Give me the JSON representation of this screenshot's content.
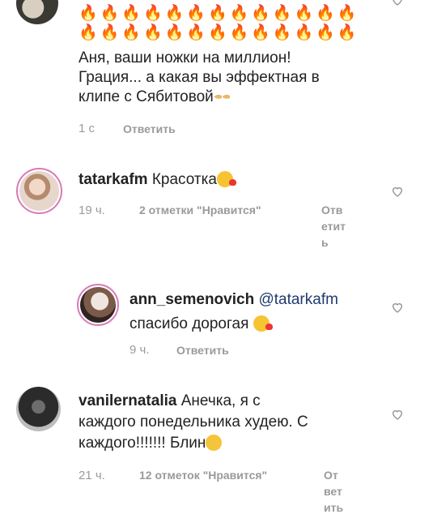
{
  "comment1": {
    "fires_row1": "🔥🔥🔥🔥🔥🔥🔥🔥🔥🔥🔥🔥🔥",
    "fires_row2": "🔥🔥🔥🔥🔥🔥🔥🔥🔥🔥🔥🔥🔥",
    "line1": "Аня, ваши ножки на миллион!",
    "line2": "Грация... а какая вы эффектная в",
    "line3": "клипе с Сябитовой",
    "time": "1 с",
    "reply": "Ответить"
  },
  "comment2": {
    "username": "tatarkafm",
    "text": "Красотка",
    "time": "19 ч.",
    "likes": "2 отметки \"Нравится\"",
    "reply_1": "Отв",
    "reply_2": "етит",
    "reply_3": "ь"
  },
  "comment3": {
    "username": "ann_semenovich",
    "mention": "@tatarkafm",
    "text": "спасибо дорогая",
    "time": "9 ч.",
    "reply": "Ответить"
  },
  "comment4": {
    "username": "vanilernatalia",
    "line1": "Анечка, я с",
    "line2": "каждого понедельника худею. С",
    "line3": "каждого!!!!!!! Блин",
    "time": "21 ч.",
    "likes": "12 отметок \"Нравится\"",
    "reply_1": "От",
    "reply_2": "вет",
    "reply_3": "ить"
  },
  "icons": {
    "heart": "heart-outline-icon",
    "fire": "fire-emoji",
    "kiss": "kiss-emoji",
    "nails": "nail-polish-emoji",
    "blush": "blush-emoji"
  },
  "colors": {
    "ring": "#d97ab8",
    "meta": "#9a9a9a",
    "mention": "#1e3a6f"
  }
}
